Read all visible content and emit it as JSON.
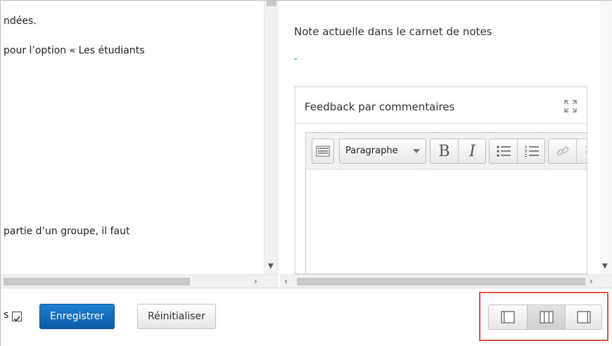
{
  "left_pane": {
    "lines": [
      "ndées.",
      "pour l’option « Les étudiants",
      "partie d’un groupe,  il faut"
    ]
  },
  "right_pane": {
    "note_title": "Note actuelle dans le carnet de notes",
    "note_value": "-",
    "feedback": {
      "title": "Feedback par commentaires",
      "toolbar": {
        "format_label": "Paragraphe",
        "bold_label": "B",
        "italic_label": "I"
      }
    }
  },
  "bottom_bar": {
    "truncated_label": "s",
    "save_label": "Enregistrer",
    "reset_label": "Réinitialiser"
  },
  "colors": {
    "primary_button": "#0b5aa5",
    "highlight_border": "#d9534f",
    "link_value": "#1177cc"
  },
  "icons": {
    "expand": "expand-icon",
    "toolbar_toggle": "keyboard-toolbar-icon",
    "bullet_list": "bullet-list-icon",
    "numbered_list": "numbered-list-icon",
    "link": "link-icon",
    "unlink": "unlink-icon",
    "layout_collapse_left": "layout-left-panel-icon",
    "layout_split": "layout-split-icon",
    "layout_collapse_right": "layout-right-panel-icon"
  }
}
